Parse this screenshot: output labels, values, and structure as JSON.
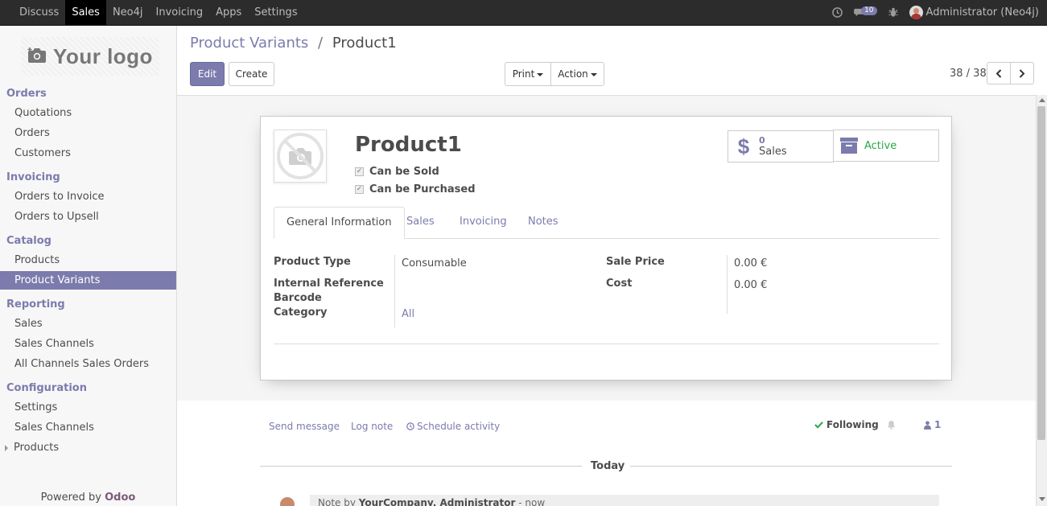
{
  "topbar": {
    "menu": [
      "Discuss",
      "Sales",
      "Neo4j",
      "Invoicing",
      "Apps",
      "Settings"
    ],
    "active_menu": "Sales",
    "messages_count": "10",
    "user_name": "Administrator (Neo4j)"
  },
  "sidebar": {
    "logo_text": "Your logo",
    "sections": {
      "orders": "Orders",
      "invoicing": "Invoicing",
      "catalog": "Catalog",
      "reporting": "Reporting",
      "configuration": "Configuration"
    },
    "items": {
      "quotations": "Quotations",
      "orders": "Orders",
      "customers": "Customers",
      "orders_to_invoice": "Orders to Invoice",
      "orders_to_upsell": "Orders to Upsell",
      "products": "Products",
      "product_variants": "Product Variants",
      "sales": "Sales",
      "sales_channels": "Sales Channels",
      "all_channels_sales_orders": "All Channels Sales Orders",
      "settings": "Settings",
      "config_sales_channels": "Sales Channels",
      "config_products": "Products"
    },
    "powered_by": "Powered by",
    "powered_brand": "Odoo"
  },
  "breadcrumb": {
    "parent": "Product Variants",
    "separator": "/",
    "current": "Product1"
  },
  "toolbar": {
    "edit": "Edit",
    "create": "Create",
    "print": "Print",
    "action": "Action"
  },
  "pager": {
    "value": "38 / 38"
  },
  "form": {
    "name": "Product1",
    "can_be_sold_label": "Can be Sold",
    "can_be_sold": true,
    "can_be_purchased_label": "Can be Purchased",
    "can_be_purchased": true,
    "stat_sales_count": "0",
    "stat_sales_label": "Sales",
    "stat_active_label": "Active",
    "tabs": [
      "General Information",
      "Sales",
      "Invoicing",
      "Notes"
    ],
    "active_tab": "General Information",
    "fields": {
      "product_type_label": "Product Type",
      "product_type": "Consumable",
      "internal_reference_label": "Internal Reference",
      "barcode_label": "Barcode",
      "category_label": "Category",
      "category": "All",
      "sale_price_label": "Sale Price",
      "sale_price": "0.00 €",
      "cost_label": "Cost",
      "cost": "0.00 €"
    }
  },
  "chatter": {
    "send_message": "Send message",
    "log_note": "Log note",
    "schedule_activity": "Schedule activity",
    "following": "Following",
    "followers_count": "1",
    "today": "Today",
    "note_prefix": "Note by",
    "note_author": "YourCompany, Administrator",
    "note_time": "- now"
  },
  "colors": {
    "accent": "#7c7bad",
    "topbar": "#2c2c2c",
    "following_check": "#28a745"
  }
}
